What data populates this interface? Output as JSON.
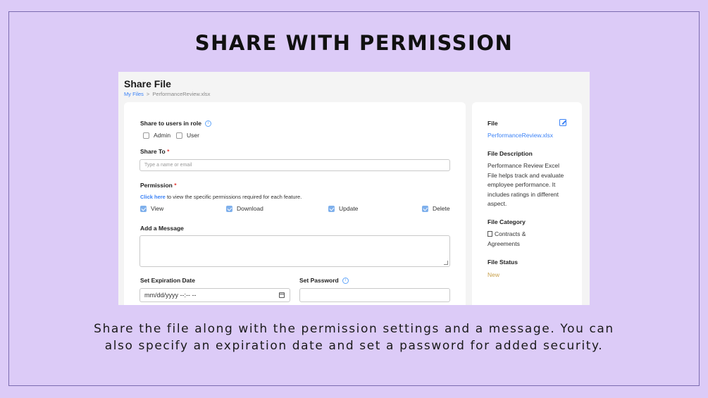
{
  "headline": "SHARE WITH PERMISSION",
  "caption_line1": "Share the file along with the permission settings and a message. You can",
  "caption_line2": "also specify an expiration date and set a password for added security.",
  "app": {
    "page_title": "Share File",
    "breadcrumb": {
      "root": "My Files",
      "separator": ">",
      "current": "PerformanceReview.xlsx"
    },
    "form": {
      "share_role_label": "Share to users in role",
      "roles": [
        {
          "label": "Admin",
          "checked": false
        },
        {
          "label": "User",
          "checked": false
        }
      ],
      "share_to_label": "Share To",
      "required_mark": "*",
      "share_to_placeholder": "Type a name or email",
      "permission_label": "Permission",
      "permission_hint_link": "Click here",
      "permission_hint_text": " to view the specific permissions required for each feature.",
      "permissions": [
        {
          "label": "View",
          "checked": true
        },
        {
          "label": "Download",
          "checked": true
        },
        {
          "label": "Update",
          "checked": true
        },
        {
          "label": "Delete",
          "checked": true
        }
      ],
      "message_label": "Add a Message",
      "expiration_label": "Set Expiration Date",
      "expiration_value": "mm/dd/yyyy --:-- --",
      "password_label": "Set Password"
    },
    "details": {
      "file_label": "File",
      "file_name": "PerformanceReview.xlsx",
      "description_label": "File Description",
      "description": "Performance Review Excel File helps track and evaluate employee performance. It includes ratings in different aspect.",
      "category_label": "File Category",
      "category": "Contracts & Agreements",
      "status_label": "File Status",
      "status": "New"
    }
  },
  "colors": {
    "background": "#dccbf7",
    "accent": "#3b82f6",
    "status": "#c8a04a",
    "required": "#e53935"
  }
}
